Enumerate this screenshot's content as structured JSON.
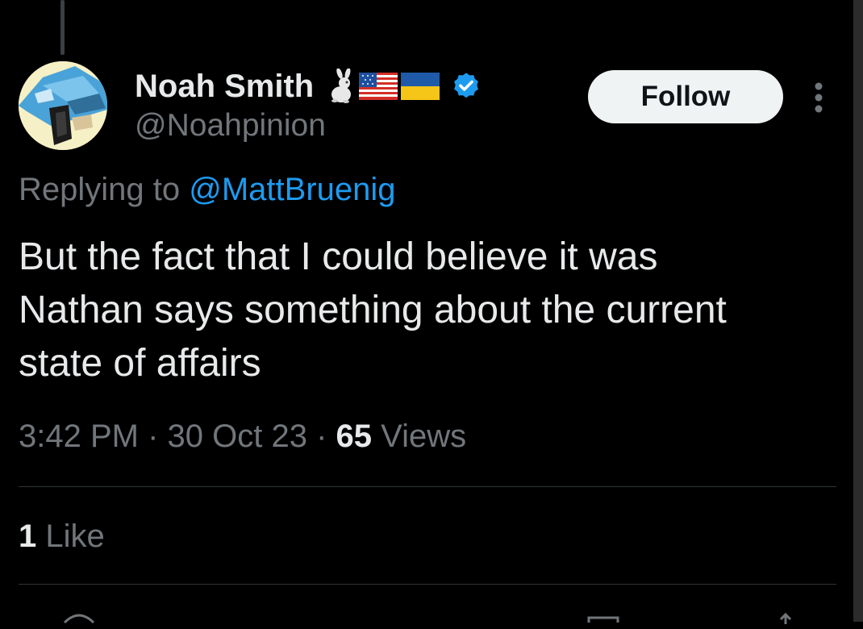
{
  "tweet": {
    "author": {
      "display_name": "Noah Smith",
      "name_emoji": [
        "rabbit-emoji",
        "us-flag-emoji",
        "ukraine-flag-emoji"
      ],
      "verified": true,
      "handle": "@Noahpinion"
    },
    "follow_label": "Follow",
    "replying_prefix": "Replying to ",
    "replying_to": "@MattBruenig",
    "text": "But the fact that I could believe it was\nNathan says something about the current\nstate of affairs",
    "time": "3:42 PM",
    "separator": " · ",
    "date": "30 Oct 23",
    "views_count": "65",
    "views_label": " Views",
    "likes_count": "1",
    "likes_label": " Like"
  },
  "colors": {
    "background": "#000000",
    "text_primary": "#e7e9ea",
    "text_secondary": "#71767b",
    "accent": "#1d9bf0",
    "divider": "#2f3336",
    "follow_bg": "#eff3f4"
  },
  "icons": [
    "more-options-icon",
    "verified-badge-icon",
    "reply-icon",
    "retweet-icon",
    "like-icon",
    "views-icon",
    "share-icon"
  ]
}
